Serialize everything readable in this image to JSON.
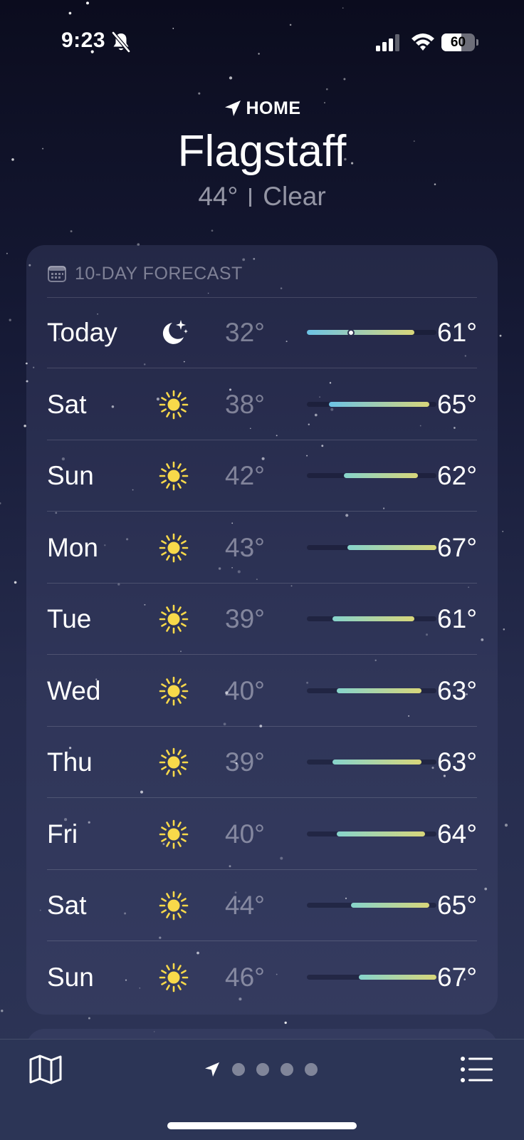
{
  "status_bar": {
    "time": "9:23",
    "battery_level": "60"
  },
  "location": {
    "label": "HOME",
    "city": "Flagstaff",
    "temperature": "44°",
    "condition": "Clear"
  },
  "forecast": {
    "title": "10-DAY FORECAST",
    "range_scale": [
      32,
      67
    ],
    "current_temperature": 44,
    "days": [
      {
        "day": "Today",
        "icon": "moon-stars-icon",
        "low": "32°",
        "high": "61°",
        "low_value": 32,
        "high_value": 61
      },
      {
        "day": "Sat",
        "icon": "sun-icon",
        "low": "38°",
        "high": "65°",
        "low_value": 38,
        "high_value": 65
      },
      {
        "day": "Sun",
        "icon": "sun-icon",
        "low": "42°",
        "high": "62°",
        "low_value": 42,
        "high_value": 62
      },
      {
        "day": "Mon",
        "icon": "sun-icon",
        "low": "43°",
        "high": "67°",
        "low_value": 43,
        "high_value": 67
      },
      {
        "day": "Tue",
        "icon": "sun-icon",
        "low": "39°",
        "high": "61°",
        "low_value": 39,
        "high_value": 61
      },
      {
        "day": "Wed",
        "icon": "sun-icon",
        "low": "40°",
        "high": "63°",
        "low_value": 40,
        "high_value": 63
      },
      {
        "day": "Thu",
        "icon": "sun-icon",
        "low": "39°",
        "high": "63°",
        "low_value": 39,
        "high_value": 63
      },
      {
        "day": "Fri",
        "icon": "sun-icon",
        "low": "40°",
        "high": "64°",
        "low_value": 40,
        "high_value": 64
      },
      {
        "day": "Sat",
        "icon": "sun-icon",
        "low": "44°",
        "high": "65°",
        "low_value": 44,
        "high_value": 65
      },
      {
        "day": "Sun",
        "icon": "sun-icon",
        "low": "46°",
        "high": "67°",
        "low_value": 46,
        "high_value": 67
      }
    ]
  },
  "toolbar": {
    "page_count": 4,
    "current_page": "current-location",
    "left_icon": "map-icon",
    "right_icon": "list-icon"
  },
  "colors": {
    "sun": "#f8d94a",
    "bar_cool": "#6cc3e6",
    "bar_mild": "#86d4cc",
    "bar_warm": "#d8d67a"
  }
}
